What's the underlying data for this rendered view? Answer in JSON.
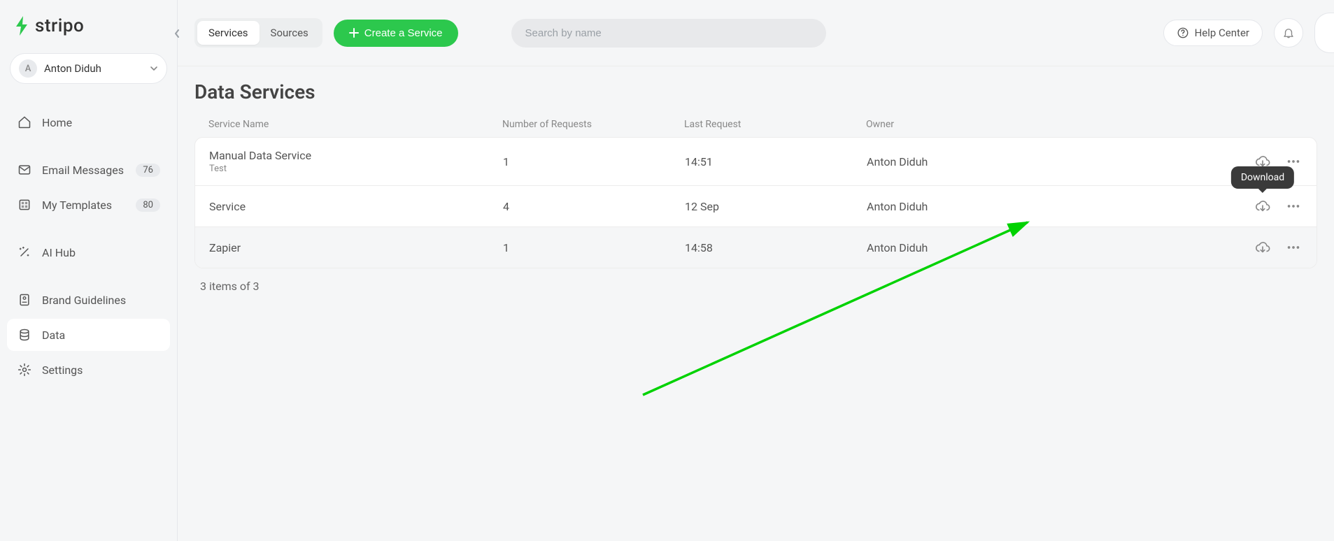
{
  "brand": {
    "name": "stripo"
  },
  "user": {
    "initial": "A",
    "name": "Anton Diduh"
  },
  "sidebar": {
    "items": [
      {
        "label": "Home"
      },
      {
        "label": "Email Messages",
        "badge": "76"
      },
      {
        "label": "My Templates",
        "badge": "80"
      },
      {
        "label": "AI Hub"
      },
      {
        "label": "Brand Guidelines"
      },
      {
        "label": "Data"
      },
      {
        "label": "Settings"
      }
    ]
  },
  "topbar": {
    "tabs": {
      "services": "Services",
      "sources": "Sources"
    },
    "create_label": "Create a Service",
    "search_placeholder": "Search by name",
    "help_label": "Help Center"
  },
  "page": {
    "title": "Data Services",
    "columns": {
      "name": "Service Name",
      "requests": "Number of Requests",
      "last": "Last Request",
      "owner": "Owner"
    },
    "rows": [
      {
        "name": "Manual Data Service",
        "sub": "Test",
        "requests": "1",
        "last": "14:51",
        "owner": "Anton Diduh"
      },
      {
        "name": "Service",
        "sub": "",
        "requests": "4",
        "last": "12 Sep",
        "owner": "Anton Diduh"
      },
      {
        "name": "Zapier",
        "sub": "",
        "requests": "1",
        "last": "14:58",
        "owner": "Anton Diduh"
      }
    ],
    "footer": "3 items of 3",
    "tooltip": "Download"
  }
}
